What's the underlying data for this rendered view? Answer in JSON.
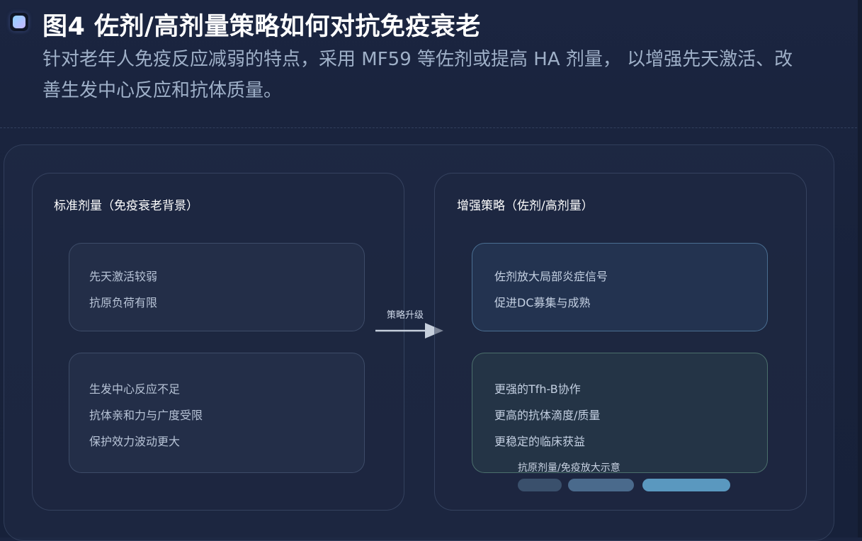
{
  "figure": {
    "title": "图4 佐剂/高剂量策略如何对抗免疫衰老",
    "subtitle": "针对老年人免疫反应减弱的特点，采用 MF59 等佐剂或提高 HA 剂量， 以增强先天激活、改善生发中心反应和抗体质量。"
  },
  "left_panel": {
    "header": "标准剂量（免疫衰老背景）",
    "box1": [
      "先天激活较弱",
      "抗原负荷有限"
    ],
    "box2": [
      "生发中心反应不足",
      "抗体亲和力与广度受限",
      "保护效力波动更大"
    ]
  },
  "arrow": {
    "label": "策略升级"
  },
  "right_panel": {
    "header": "增强策略（佐剂/高剂量）",
    "box1": [
      "佐剂放大局部炎症信号",
      "促进DC募集与成熟"
    ],
    "box2": [
      "更强的Tfh-B协作",
      "更高的抗体滴度/质量",
      "更稳定的临床获益"
    ]
  },
  "scale": {
    "label": "抗原剂量/免疫放大示意",
    "levels": [
      {
        "level": 1,
        "color": "#3a506c"
      },
      {
        "level": 1.5,
        "color": "#4a6a8c"
      },
      {
        "level": 2,
        "color": "#5a98bf"
      }
    ]
  },
  "colors": {
    "background": "#1b2540",
    "accent": "#5a98bf",
    "title": "#ffffff",
    "subtitle": "#9fb0c8"
  }
}
